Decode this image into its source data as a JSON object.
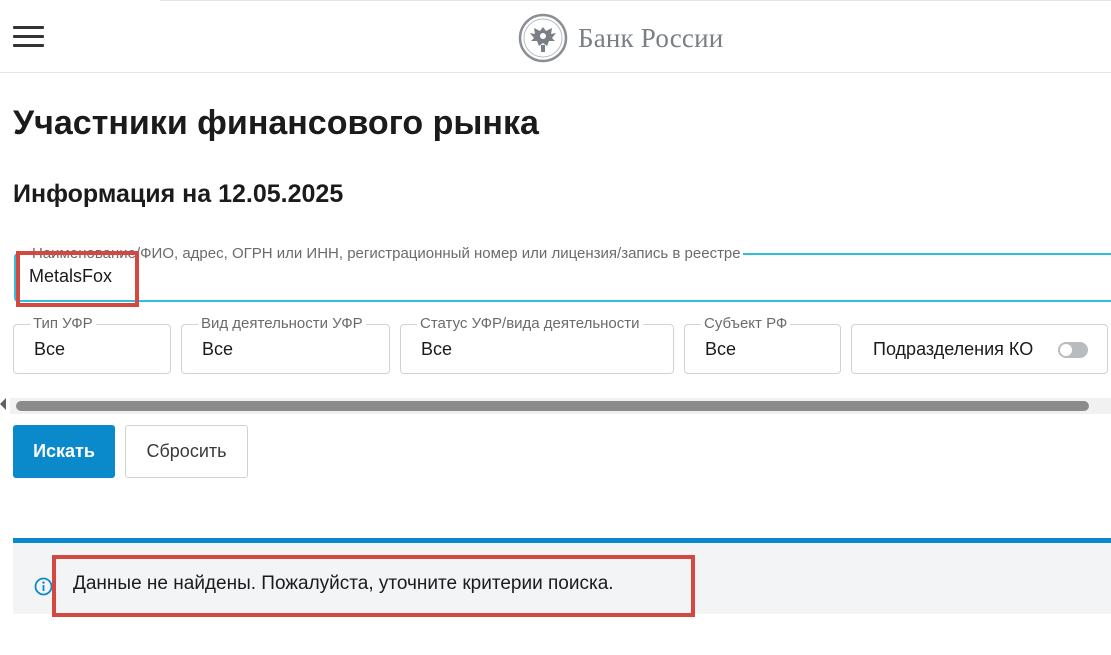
{
  "header": {
    "menu_icon": "hamburger-menu-icon",
    "logo_icon": "double-headed-eagle-emblem-icon",
    "brand": "Банк России"
  },
  "page": {
    "title": "Участники финансового рынка",
    "info_date": "Информация на 12.05.2025"
  },
  "search": {
    "label": "Наименование/ФИО, адрес, ОГРН или ИНН, регистрационный номер или лицензия/запись в реестре",
    "value": "MetalsFox"
  },
  "filters": [
    {
      "label": "Тип УФР",
      "value": "Все"
    },
    {
      "label": "Вид деятельности УФР",
      "value": "Все"
    },
    {
      "label": "Статус УФР/вида деятельности",
      "value": "Все"
    },
    {
      "label": "Субъект РФ",
      "value": "Все"
    }
  ],
  "toggle": {
    "label": "Подразделения КО",
    "checked": false
  },
  "buttons": {
    "search": "Искать",
    "reset": "Сбросить"
  },
  "alert": {
    "icon": "info-icon",
    "text": "Данные не найдены. Пожалуйста, уточните критерии поиска."
  },
  "colors": {
    "accent": "#0b8acb",
    "input_focus": "#2fc0e1",
    "highlight": "#d3493f",
    "alert_bg": "#f2f4f5"
  }
}
